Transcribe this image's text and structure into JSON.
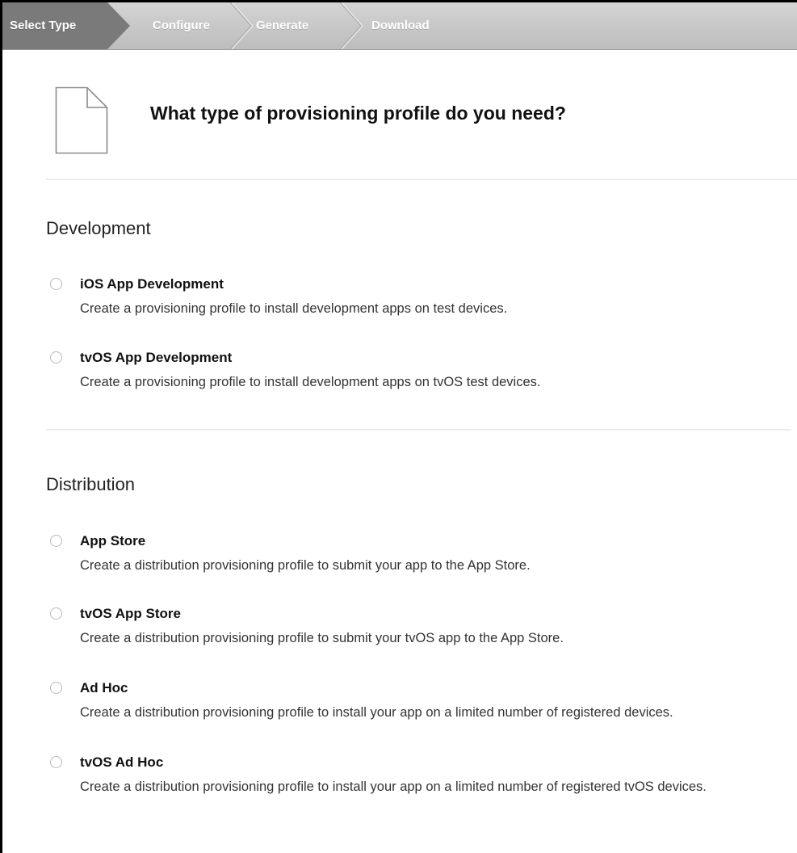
{
  "wizard": {
    "steps": [
      "Select Type",
      "Configure",
      "Generate",
      "Download"
    ]
  },
  "header": {
    "title": "What type of provisioning profile do you need?",
    "icon": "document-icon"
  },
  "development": {
    "title": "Development",
    "options": [
      {
        "label": "iOS App Development",
        "description": "Create a provisioning profile to install development apps on test devices."
      },
      {
        "label": "tvOS App Development",
        "description": "Create a provisioning profile to install development apps on tvOS test devices."
      }
    ]
  },
  "distribution": {
    "title": "Distribution",
    "options": [
      {
        "label": "App Store",
        "description": "Create a distribution provisioning profile to submit your app to the App Store."
      },
      {
        "label": "tvOS App Store",
        "description": "Create a distribution provisioning profile to submit your tvOS app to the App Store."
      },
      {
        "label": "Ad Hoc",
        "description": "Create a distribution provisioning profile to install your app on a limited number of registered devices."
      },
      {
        "label": "tvOS Ad Hoc",
        "description": "Create a distribution provisioning profile to install your app on a limited number of registered tvOS devices."
      }
    ]
  },
  "colors": {
    "active_step": "#7a7a7a",
    "step_bar": "#c8c8c8"
  }
}
